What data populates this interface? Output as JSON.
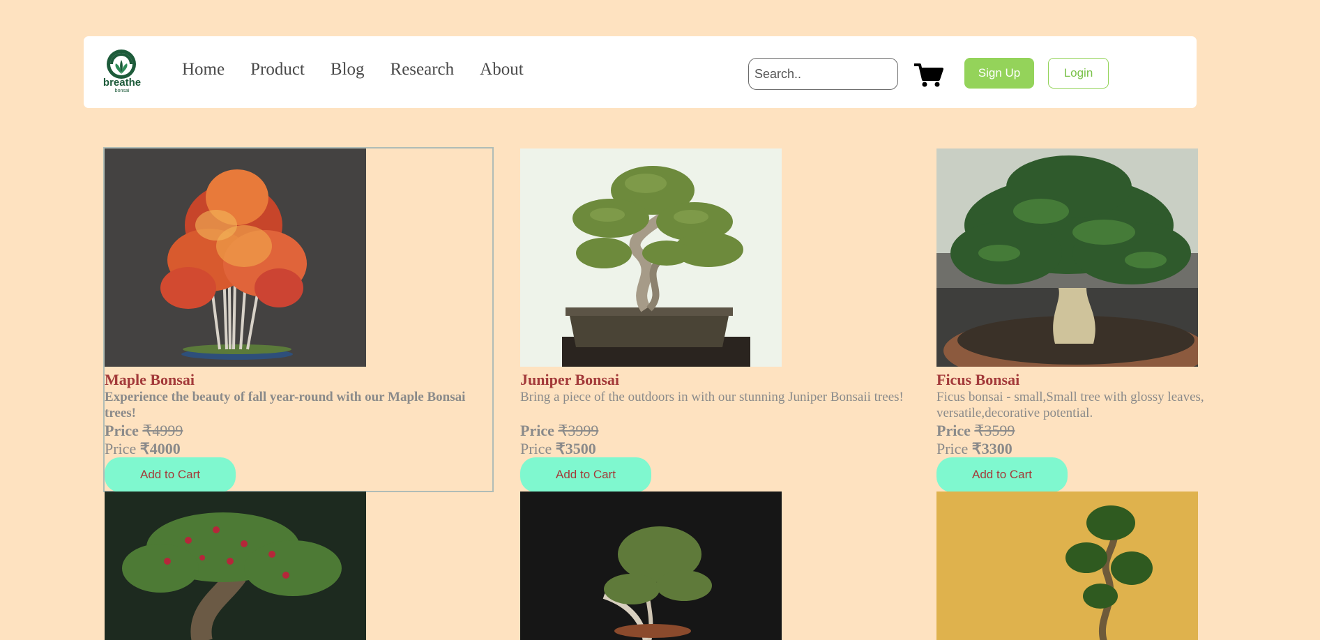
{
  "brand": {
    "name": "breathe",
    "tagline": "bonsai"
  },
  "nav": {
    "items": [
      "Home",
      "Product",
      "Blog",
      "Research",
      "About"
    ]
  },
  "search": {
    "placeholder": "Search.."
  },
  "cart": {
    "icon": "cart-icon"
  },
  "auth": {
    "signup_label": "Sign Up",
    "login_label": "Login"
  },
  "colors": {
    "background": "#fee2c0",
    "accent_green": "#94d35a",
    "button_mint": "#7ff8cf",
    "title_red": "#a33a3a"
  },
  "products": [
    {
      "title": "Maple Bonsai",
      "description": "Experience the beauty of fall year-round with our Maple Bonsai trees!",
      "old_price_label": "Price",
      "old_price": "₹4999",
      "new_price_label": "Price",
      "new_price": "₹4000",
      "button_label": "Add to Cart"
    },
    {
      "title": "Juniper Bonsai",
      "description": "Bring a piece of the outdoors in with our stunning Juniper Bonsaii trees!",
      "old_price_label": "Price",
      "old_price": "₹3999",
      "new_price_label": "Price",
      "new_price": "₹3500",
      "button_label": "Add to Cart"
    },
    {
      "title": "Ficus Bonsai",
      "description": "Ficus bonsai - small,Small tree with glossy leaves, versatile,decorative potential.",
      "old_price_label": "Price",
      "old_price": "₹3599",
      "new_price_label": "Price",
      "new_price": "₹3300",
      "button_label": "Add to Cart"
    }
  ]
}
